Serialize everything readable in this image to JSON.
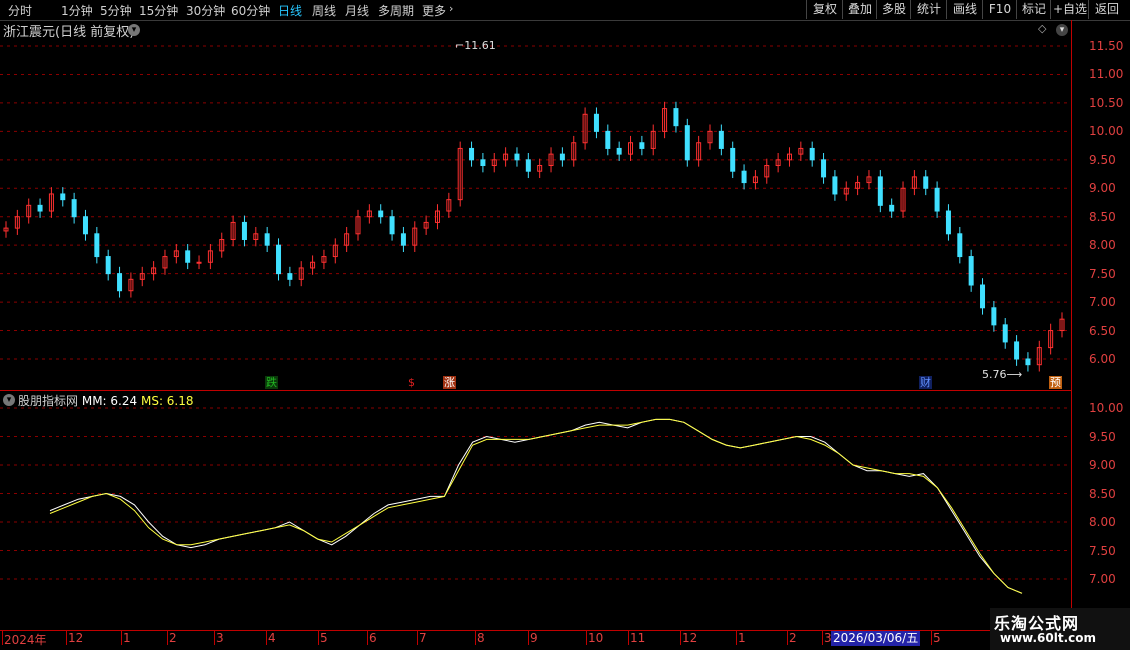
{
  "toolbar": {
    "periods": [
      "分时",
      "1分钟",
      "5分钟",
      "15分钟",
      "30分钟",
      "60分钟",
      "日线",
      "周线",
      "月线",
      "多周期",
      "更多"
    ],
    "active_period": "日线",
    "buttons": [
      "复权",
      "叠加",
      "多股",
      "统计",
      "画线",
      "F10",
      "标记",
      "+自选",
      "返回"
    ]
  },
  "stock_title": "浙江震元(日线 前复权)",
  "indicator": {
    "name": "股朋指标网",
    "mm_label": "MM: 6.24",
    "ms_label": "MS: 6.18"
  },
  "signals": [
    {
      "text": "跌",
      "color": "#22b522",
      "bg": "#0a3a0a"
    },
    {
      "text": "$",
      "color": "#e02020",
      "bg": "#000"
    },
    {
      "text": "涨",
      "color": "#ffffff",
      "bg": "#a03010"
    },
    {
      "text": "财",
      "color": "#6090ff",
      "bg": "#102060"
    },
    {
      "text": "预",
      "color": "#ffffff",
      "bg": "#c06010"
    }
  ],
  "annotations": {
    "high": "11.61",
    "low": "5.76"
  },
  "x_axis": {
    "labels": [
      "2024年",
      "12",
      "1",
      "2",
      "3",
      "4",
      "5",
      "6",
      "7",
      "8",
      "9",
      "10",
      "11",
      "12",
      "1",
      "2",
      "3",
      "5"
    ],
    "current_date": "2026/03/06/五"
  },
  "watermark": {
    "line1": "乐淘公式网",
    "line2": "www.60lt.com"
  },
  "chart_data": [
    {
      "type": "candlestick",
      "title": "浙江震元(日线 前复权)",
      "y_ticks": [
        "11.50",
        "11.00",
        "10.50",
        "10.00",
        "9.50",
        "9.00",
        "8.50",
        "8.00",
        "7.50",
        "7.00",
        "6.50",
        "6.00"
      ],
      "ylim": [
        5.7,
        11.7
      ],
      "up_color": "#ff3030",
      "down_color": "#40e0ff",
      "close": [
        8.3,
        8.5,
        8.7,
        8.6,
        8.9,
        8.8,
        8.5,
        8.2,
        7.8,
        7.5,
        7.2,
        7.4,
        7.5,
        7.6,
        7.8,
        7.9,
        7.7,
        7.7,
        7.9,
        8.1,
        8.4,
        8.1,
        8.2,
        8.0,
        7.5,
        7.4,
        7.6,
        7.7,
        7.8,
        8.0,
        8.2,
        8.5,
        8.6,
        8.5,
        8.2,
        8.0,
        8.3,
        8.4,
        8.6,
        8.8,
        9.7,
        9.5,
        9.4,
        9.5,
        9.6,
        9.5,
        9.3,
        9.4,
        9.6,
        9.5,
        9.8,
        10.3,
        10.0,
        9.7,
        9.6,
        9.8,
        9.7,
        10.0,
        10.4,
        10.1,
        9.5,
        9.8,
        10.0,
        9.7,
        9.3,
        9.1,
        9.2,
        9.4,
        9.5,
        9.6,
        9.7,
        9.5,
        9.2,
        8.9,
        9.0,
        9.1,
        9.2,
        8.7,
        8.6,
        9.0,
        9.2,
        9.0,
        8.6,
        8.2,
        7.8,
        7.3,
        6.9,
        6.6,
        6.3,
        6.0,
        5.9,
        6.2,
        6.5,
        6.7
      ]
    },
    {
      "type": "line",
      "title": "股朋指标网",
      "y_ticks": [
        "10.00",
        "9.50",
        "9.00",
        "8.50",
        "8.00",
        "7.50",
        "7.00"
      ],
      "ylim": [
        6.75,
        10.2
      ],
      "series": [
        {
          "name": "MM",
          "color": "#ffffff",
          "values": [
            8.2,
            8.3,
            8.4,
            8.45,
            8.5,
            8.45,
            8.3,
            8.0,
            7.75,
            7.6,
            7.55,
            7.6,
            7.7,
            7.75,
            7.8,
            7.85,
            7.9,
            8.0,
            7.85,
            7.7,
            7.6,
            7.75,
            7.95,
            8.15,
            8.3,
            8.35,
            8.4,
            8.45,
            8.45,
            9.0,
            9.4,
            9.5,
            9.45,
            9.4,
            9.45,
            9.5,
            9.55,
            9.6,
            9.7,
            9.75,
            9.7,
            9.65,
            9.75,
            9.8,
            9.8,
            9.75,
            9.6,
            9.45,
            9.35,
            9.3,
            9.35,
            9.4,
            9.45,
            9.5,
            9.5,
            9.4,
            9.2,
            9.0,
            8.9,
            8.9,
            8.85,
            8.8,
            8.85,
            8.6,
            8.2,
            7.8,
            7.4,
            7.1,
            6.85,
            6.75
          ]
        },
        {
          "name": "MS",
          "color": "#ffff40",
          "values": [
            8.15,
            8.25,
            8.35,
            8.45,
            8.5,
            8.4,
            8.2,
            7.9,
            7.7,
            7.6,
            7.6,
            7.65,
            7.7,
            7.75,
            7.8,
            7.85,
            7.9,
            7.95,
            7.85,
            7.7,
            7.65,
            7.8,
            7.95,
            8.1,
            8.25,
            8.3,
            8.35,
            8.4,
            8.45,
            8.9,
            9.35,
            9.45,
            9.45,
            9.45,
            9.45,
            9.5,
            9.55,
            9.6,
            9.65,
            9.7,
            9.7,
            9.7,
            9.75,
            9.8,
            9.8,
            9.75,
            9.6,
            9.45,
            9.35,
            9.3,
            9.35,
            9.4,
            9.45,
            9.5,
            9.45,
            9.35,
            9.2,
            9.0,
            8.95,
            8.9,
            8.85,
            8.85,
            8.8,
            8.6,
            8.25,
            7.85,
            7.45,
            7.1,
            6.85,
            6.75
          ]
        }
      ]
    }
  ]
}
